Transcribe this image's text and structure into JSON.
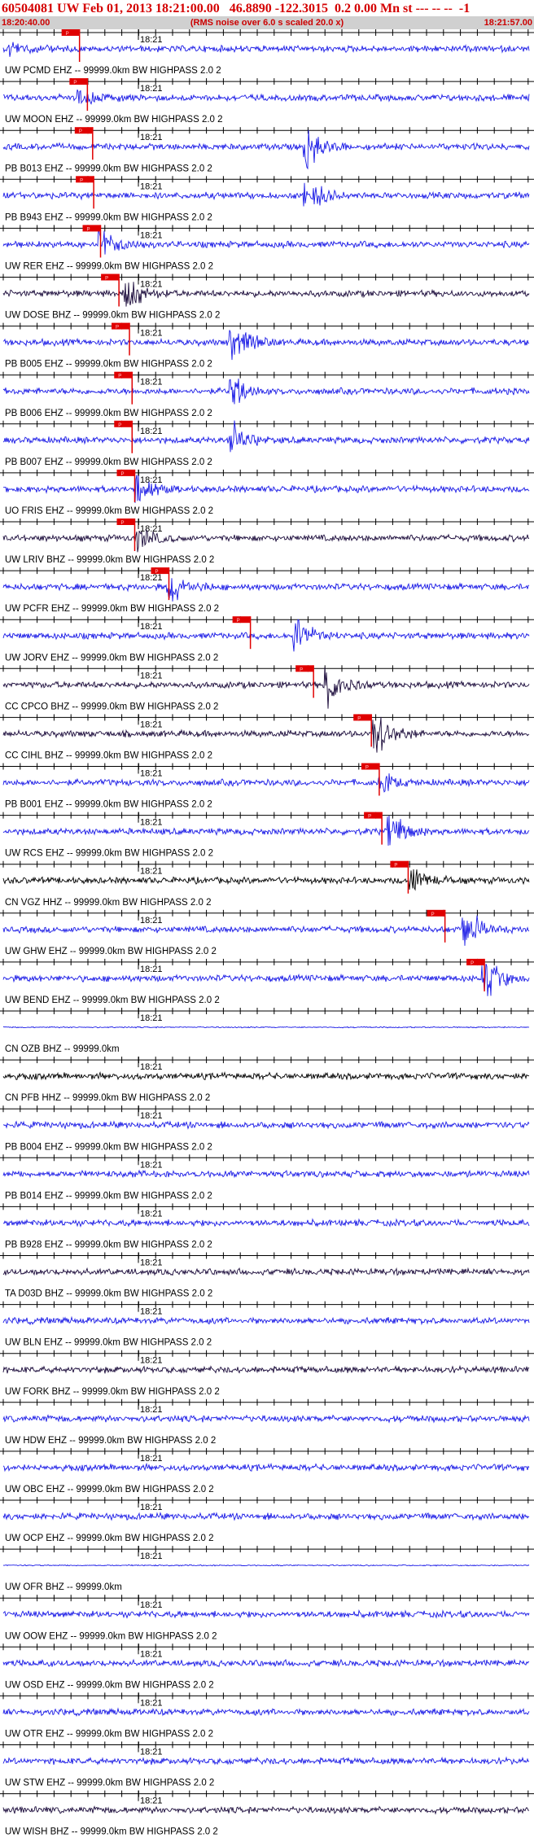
{
  "header": {
    "title": "60504081 UW Feb 01, 2013 18:21:00.00   46.8890 -122.3015  0.2 0.00 Mn st --- -- --  -1",
    "start_time": "18:20:40.00",
    "note": "(RMS noise over 6.0 s scaled 20.0 x)",
    "end_time": "18:21:57.00"
  },
  "time_tick_label": "18:21",
  "pick_label": "P",
  "colors": {
    "trace_blue": "#1a1ae6",
    "trace_dark": "#1a0a3a",
    "trace_black": "#000000",
    "pick_red": "#e00000",
    "title_red": "#d40000",
    "axis": "#000000"
  },
  "channels": [
    {
      "label": "UW PCMD EHZ -- 99999.0km BW  HIGHPASS  2.0  2",
      "color": "blue",
      "pick": 0.145,
      "event": 0.02,
      "event_amp": 0.5
    },
    {
      "label": "UW MOON EHZ -- 99999.0km BW  HIGHPASS  2.0  2",
      "color": "blue",
      "pick": 0.16,
      "event": 0.15,
      "event_amp": 0.6
    },
    {
      "label": "PB B013 EHZ -- 99999.0km BW  HIGHPASS  2.0  2",
      "color": "blue",
      "pick": 0.17,
      "event": 0.58,
      "event_amp": 1.4
    },
    {
      "label": "PB B943 EHZ -- 99999.0km BW  HIGHPASS  2.0  2",
      "color": "blue",
      "pick": 0.172,
      "event": 0.58,
      "event_amp": 1.2
    },
    {
      "label": "UW RER EHZ -- 99999.0km BW  HIGHPASS  2.0  2",
      "color": "blue",
      "pick": 0.185,
      "event": 0.19,
      "event_amp": 1.0
    },
    {
      "label": "UW DOSE BHZ -- 99999.0km BW  HIGHPASS  2.0  2",
      "color": "dark",
      "pick": 0.22,
      "event": 0.24,
      "event_amp": 1.1
    },
    {
      "label": "PB B005 EHZ -- 99999.0km BW  HIGHPASS  2.0  2",
      "color": "blue",
      "pick": 0.24,
      "event": 0.44,
      "event_amp": 1.2
    },
    {
      "label": "PB B006 EHZ -- 99999.0km BW  HIGHPASS  2.0  2",
      "color": "blue",
      "pick": 0.245,
      "event": 0.44,
      "event_amp": 1.0
    },
    {
      "label": "PB B007 EHZ -- 99999.0km BW  HIGHPASS  2.0  2",
      "color": "blue",
      "pick": 0.245,
      "event": 0.44,
      "event_amp": 1.0
    },
    {
      "label": "UO FRIS EHZ -- 99999.0km BW  HIGHPASS  2.0  2",
      "color": "blue",
      "pick": 0.25,
      "event": 0.26,
      "event_amp": 0.9
    },
    {
      "label": "UW LRIV BHZ -- 99999.0km BW  HIGHPASS  2.0  2",
      "color": "dark",
      "pick": 0.25,
      "event": 0.26,
      "event_amp": 0.7
    },
    {
      "label": "UW PCFR EHZ -- 99999.0km BW  HIGHPASS  2.0  2",
      "color": "blue",
      "pick": 0.315,
      "event": 0.32,
      "event_amp": 1.2
    },
    {
      "label": "UW JORV EHZ -- 99999.0km BW  HIGHPASS  2.0  2",
      "color": "blue",
      "pick": 0.47,
      "event": 0.56,
      "event_amp": 1.3
    },
    {
      "label": "CC CPCO BHZ -- 99999.0km BW  HIGHPASS  2.0  2",
      "color": "dark",
      "pick": 0.59,
      "event": 0.62,
      "event_amp": 1.4
    },
    {
      "label": "CC CIHL BHZ -- 99999.0km BW  HIGHPASS  2.0  2",
      "color": "dark",
      "pick": 0.7,
      "event": 0.71,
      "event_amp": 1.4
    },
    {
      "label": "PB B001 EHZ -- 99999.0km BW  HIGHPASS  2.0  2",
      "color": "blue",
      "pick": 0.715,
      "event": 0.72,
      "event_amp": 0.6
    },
    {
      "label": "UW RCS EHZ -- 99999.0km BW  HIGHPASS  2.0  2",
      "color": "blue",
      "pick": 0.72,
      "event": 0.74,
      "event_amp": 1.1
    },
    {
      "label": "CN VGZ HHZ -- 99999.0km BW  HIGHPASS  2.0  2",
      "color": "black",
      "pick": 0.77,
      "event": 0.78,
      "event_amp": 0.8
    },
    {
      "label": "UW GHW EHZ -- 99999.0km BW  HIGHPASS  2.0  2",
      "color": "blue",
      "pick": 0.84,
      "event": 0.88,
      "event_amp": 1.5
    },
    {
      "label": "UW BEND EHZ -- 99999.0km BW  HIGHPASS  2.0  2",
      "color": "blue",
      "pick": 0.915,
      "event": 0.92,
      "event_amp": 1.3
    },
    {
      "label": "CN OZB BHZ -- 99999.0km",
      "color": "blue",
      "pick": null,
      "flat": true
    },
    {
      "label": "CN PFB HHZ -- 99999.0km BW  HIGHPASS  2.0  2",
      "color": "black",
      "pick": null
    },
    {
      "label": "PB B004 EHZ -- 99999.0km BW  HIGHPASS  2.0  2",
      "color": "blue",
      "pick": null
    },
    {
      "label": "PB B014 EHZ -- 99999.0km BW  HIGHPASS  2.0  2",
      "color": "blue",
      "pick": null
    },
    {
      "label": "PB B928 EHZ -- 99999.0km BW  HIGHPASS  2.0  2",
      "color": "blue",
      "pick": null
    },
    {
      "label": "TA D03D BHZ -- 99999.0km BW  HIGHPASS  2.0  2",
      "color": "dark",
      "pick": null
    },
    {
      "label": "UW BLN EHZ -- 99999.0km BW  HIGHPASS  2.0  2",
      "color": "blue",
      "pick": null
    },
    {
      "label": "UW FORK BHZ -- 99999.0km BW  HIGHPASS  2.0  2",
      "color": "dark",
      "pick": null
    },
    {
      "label": "UW HDW EHZ -- 99999.0km BW  HIGHPASS  2.0  2",
      "color": "blue",
      "pick": null
    },
    {
      "label": "UW OBC EHZ -- 99999.0km BW  HIGHPASS  2.0  2",
      "color": "blue",
      "pick": null
    },
    {
      "label": "UW OCP EHZ -- 99999.0km BW  HIGHPASS  2.0  2",
      "color": "blue",
      "pick": null
    },
    {
      "label": "UW OFR BHZ -- 99999.0km",
      "color": "blue",
      "pick": null,
      "flat": true
    },
    {
      "label": "UW OOW EHZ -- 99999.0km BW  HIGHPASS  2.0  2",
      "color": "blue",
      "pick": null
    },
    {
      "label": "UW OSD EHZ -- 99999.0km BW  HIGHPASS  2.0  2",
      "color": "blue",
      "pick": null
    },
    {
      "label": "UW OTR EHZ -- 99999.0km BW  HIGHPASS  2.0  2",
      "color": "blue",
      "pick": null
    },
    {
      "label": "UW STW EHZ -- 99999.0km BW  HIGHPASS  2.0  2",
      "color": "blue",
      "pick": null
    },
    {
      "label": "UW WISH BHZ -- 99999.0km BW  HIGHPASS  2.0  2",
      "color": "dark",
      "pick": null
    }
  ]
}
